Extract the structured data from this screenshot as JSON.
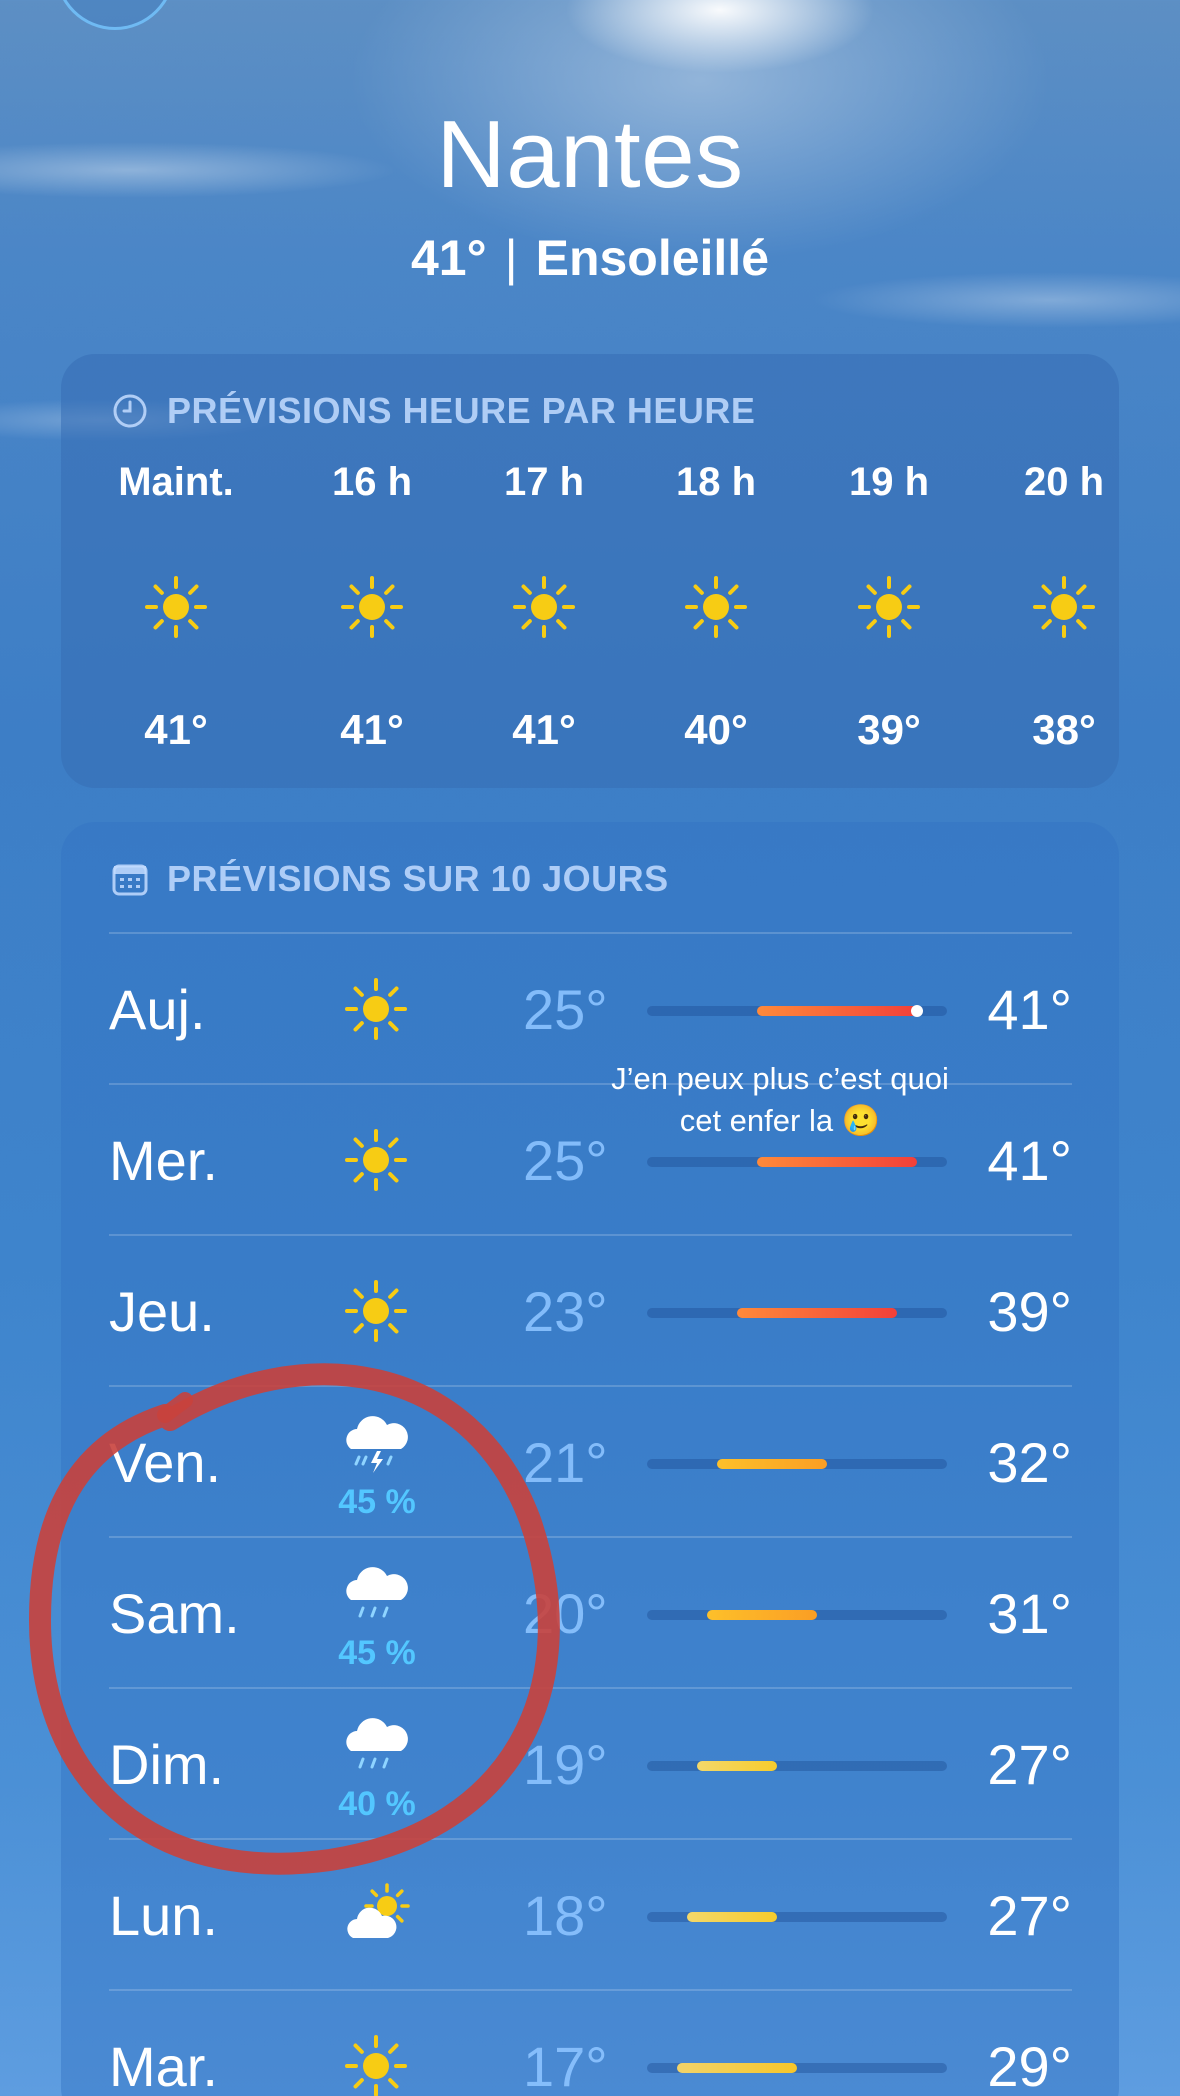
{
  "colors": {
    "sun": "#f7cc14",
    "precip": "#53c7ff",
    "annotation": "#c9413c"
  },
  "header": {
    "city": "Nantes",
    "temp": "41°",
    "separator": "|",
    "condition": "Ensoleillé"
  },
  "hourly": {
    "title": "PRÉVISIONS HEURE PAR HEURE",
    "icon": "clock-icon",
    "hours": [
      {
        "label": "Maint.",
        "icon": "sun-icon",
        "temp": "41°"
      },
      {
        "label": "16 h",
        "icon": "sun-icon",
        "temp": "41°"
      },
      {
        "label": "17 h",
        "icon": "sun-icon",
        "temp": "41°"
      },
      {
        "label": "18 h",
        "icon": "sun-icon",
        "temp": "40°"
      },
      {
        "label": "19 h",
        "icon": "sun-icon",
        "temp": "39°"
      },
      {
        "label": "20 h",
        "icon": "sun-icon",
        "temp": "38°"
      }
    ]
  },
  "daily": {
    "title": "PRÉVISIONS SUR 10 JOURS",
    "icon": "calendar-icon",
    "days": [
      {
        "day": "Auj.",
        "icon": "sun-icon",
        "precip": "",
        "low": "25°",
        "high": "41°",
        "range": [
          25,
          41
        ],
        "current": 41
      },
      {
        "day": "Mer.",
        "icon": "sun-icon",
        "precip": "",
        "low": "25°",
        "high": "41°",
        "range": [
          25,
          41
        ]
      },
      {
        "day": "Jeu.",
        "icon": "sun-icon",
        "precip": "",
        "low": "23°",
        "high": "39°",
        "range": [
          23,
          39
        ]
      },
      {
        "day": "Ven.",
        "icon": "thunderstorm-icon",
        "precip": "45 %",
        "low": "21°",
        "high": "32°",
        "range": [
          21,
          32
        ]
      },
      {
        "day": "Sam.",
        "icon": "rain-icon",
        "precip": "45 %",
        "low": "20°",
        "high": "31°",
        "range": [
          20,
          31
        ]
      },
      {
        "day": "Dim.",
        "icon": "rain-icon",
        "precip": "40 %",
        "low": "19°",
        "high": "27°",
        "range": [
          19,
          27
        ]
      },
      {
        "day": "Lun.",
        "icon": "partly-sunny-icon",
        "precip": "",
        "low": "18°",
        "high": "27°",
        "range": [
          18,
          27
        ]
      },
      {
        "day": "Mar.",
        "icon": "sun-icon",
        "precip": "",
        "low": "17°",
        "high": "29°",
        "range": [
          17,
          29
        ]
      }
    ],
    "scale": [
      14,
      44
    ]
  },
  "caption": {
    "line1": "J’en peux plus c’est quoi",
    "line2": "cet enfer la 🥲"
  }
}
